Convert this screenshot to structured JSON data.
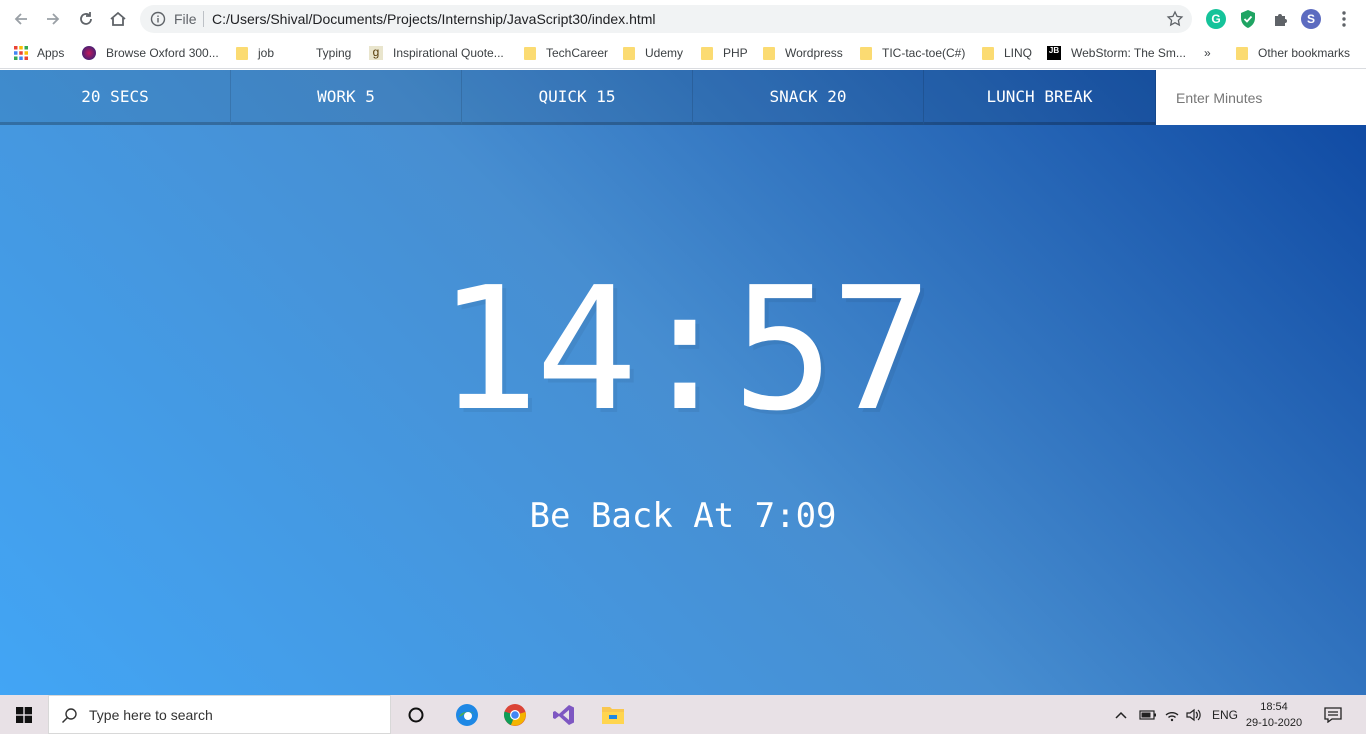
{
  "browser": {
    "file_label": "File",
    "url": "C:/Users/Shival/Documents/Projects/Internship/JavaScript30/index.html",
    "profile_initial": "S",
    "grammarly_letter": "G",
    "bookmarks": [
      {
        "label": "Apps",
        "icon": "apps-grid-icon"
      },
      {
        "label": "Browse Oxford 300...",
        "icon": "oxford-icon"
      },
      {
        "label": "job",
        "icon": "folder-icon"
      },
      {
        "label": "Typing",
        "icon": "none"
      },
      {
        "label": "Inspirational Quote...",
        "icon": "goodreads-icon"
      },
      {
        "label": "TechCareer",
        "icon": "folder-icon"
      },
      {
        "label": "Udemy",
        "icon": "folder-icon"
      },
      {
        "label": "PHP",
        "icon": "folder-icon"
      },
      {
        "label": "Wordpress",
        "icon": "folder-icon"
      },
      {
        "label": "TIC-tac-toe(C#)",
        "icon": "folder-icon"
      },
      {
        "label": "LINQ",
        "icon": "folder-icon"
      },
      {
        "label": "WebStorm: The Sm...",
        "icon": "jetbrains-icon"
      }
    ],
    "overflow": "»",
    "other_bookmarks": "Other bookmarks"
  },
  "app": {
    "buttons": [
      "20 SECS",
      "WORK 5",
      "QUICK 15",
      "SNACK 20",
      "LUNCH BREAK"
    ],
    "input_placeholder": "Enter Minutes",
    "time_left": "14:57",
    "end_time": "Be Back At 7:09",
    "gradient": [
      "#42a5f5",
      "#478ed1",
      "#0d47a1"
    ]
  },
  "taskbar": {
    "search_placeholder": "Type here to search",
    "language": "ENG",
    "time": "18:54",
    "date": "29-10-2020"
  }
}
